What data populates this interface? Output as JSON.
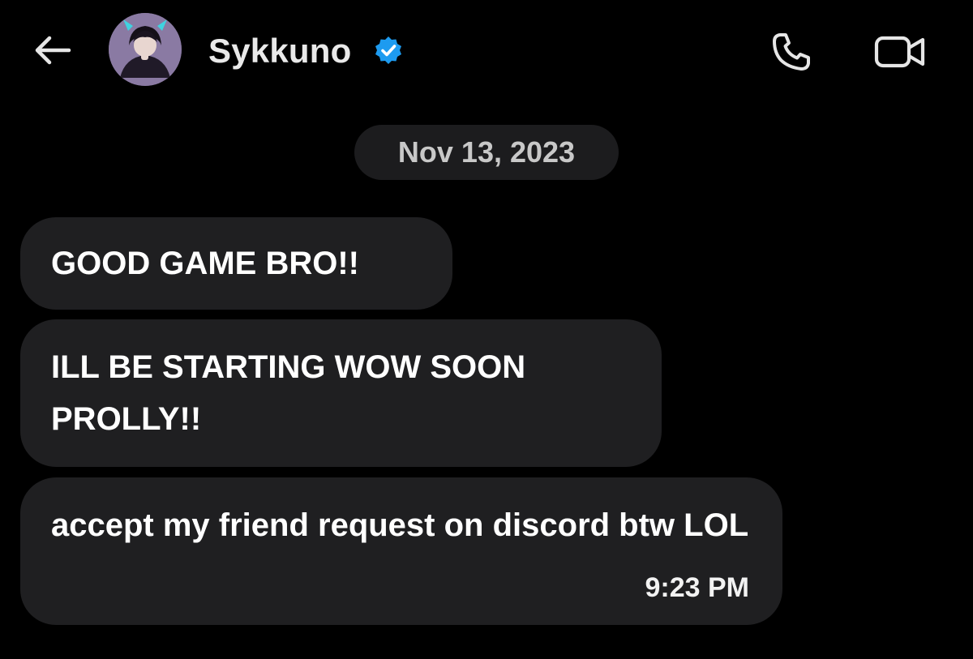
{
  "header": {
    "back_icon": "arrow-left-icon",
    "contact_name": "Sykkuno",
    "verified_badge_color": "#1d9bf0",
    "call_icon": "phone-icon",
    "video_icon": "video-camera-icon"
  },
  "conversation": {
    "date": "Nov 13, 2023",
    "messages": [
      {
        "text": "GOOD GAME BRO!!"
      },
      {
        "text": "ILL BE STARTING WOW SOON PROLLY!!"
      },
      {
        "text": "accept my friend request on discord btw LOL",
        "time": "9:23 PM"
      }
    ]
  },
  "colors": {
    "background": "#000000",
    "bubble": "#1f1f21",
    "date_pill": "#1c1c1e"
  }
}
